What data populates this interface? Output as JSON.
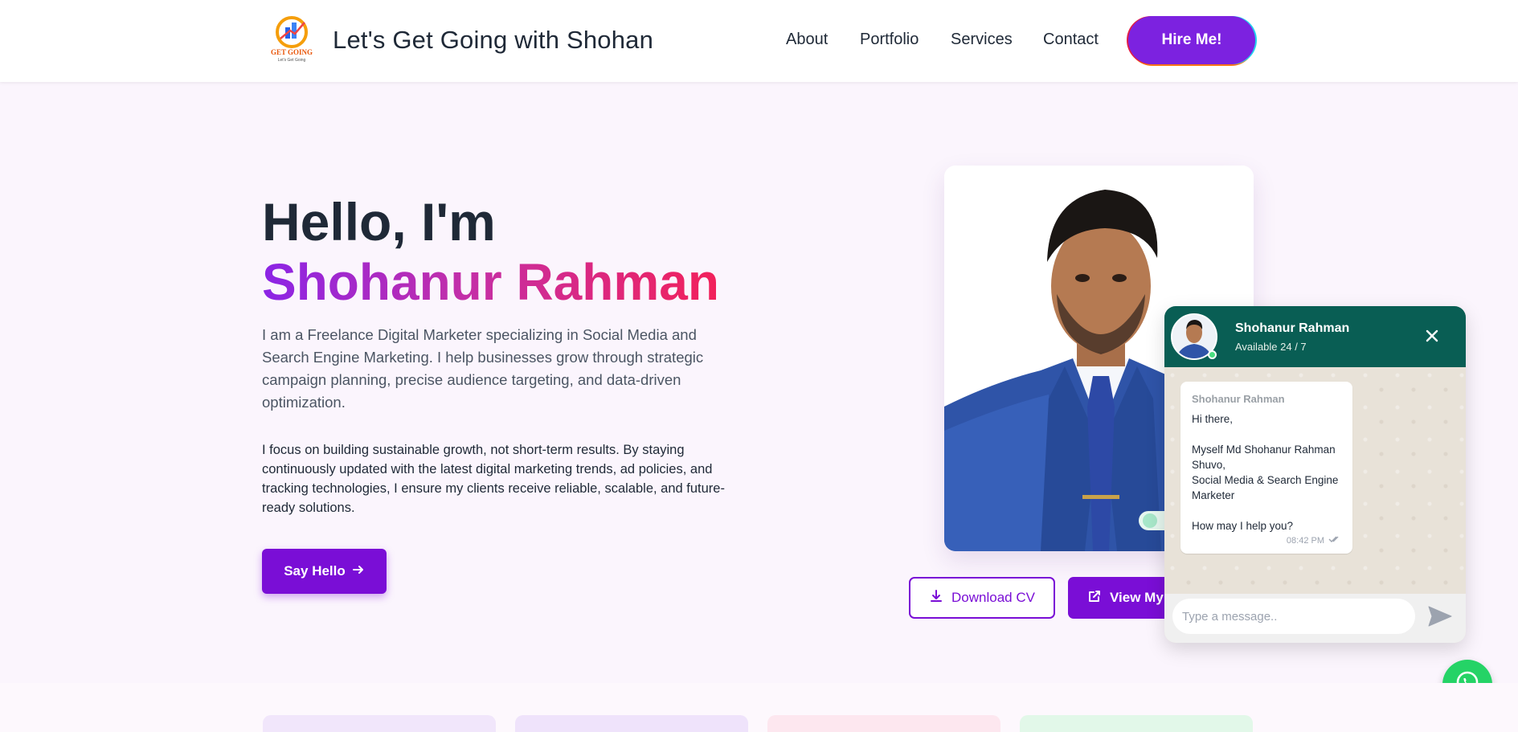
{
  "header": {
    "logo_alt": "GET GOING",
    "brand": "Let's Get Going with Shohan",
    "nav": [
      "About",
      "Portfolio",
      "Services",
      "Contact"
    ],
    "hire_label": "Hire Me!"
  },
  "hero": {
    "greeting": "Hello, I'm",
    "name": "Shohanur Rahman",
    "intro": "I am a Freelance Digital Marketer specializing in Social Media and Search Engine Marketing. I help businesses grow through strategic campaign planning, precise audience targeting, and data-driven optimization.",
    "focus": "I focus on building sustainable growth, not short-term results. By staying continuously updated with the latest digital marketing trends, ad policies, and tracking technologies, I ensure my clients receive reliable, scalable, and future-ready solutions.",
    "say_hello_label": "Say Hello",
    "download_cv_label": "Download CV",
    "view_my_label": "View My"
  },
  "chat": {
    "name": "Shohanur Rahman",
    "status": "Available 24 / 7",
    "sender": "Shohanur Rahman",
    "message": "Hi there,\n\nMyself Md Shohanur Rahman Shuvo,\nSocial Media & Search Engine Marketer\n\nHow may I help you?",
    "time": "08:42 PM",
    "input_placeholder": "Type a message.."
  },
  "colors": {
    "accent": "#7a0ed6",
    "chat_header": "#095e54",
    "whatsapp": "#25d366"
  }
}
